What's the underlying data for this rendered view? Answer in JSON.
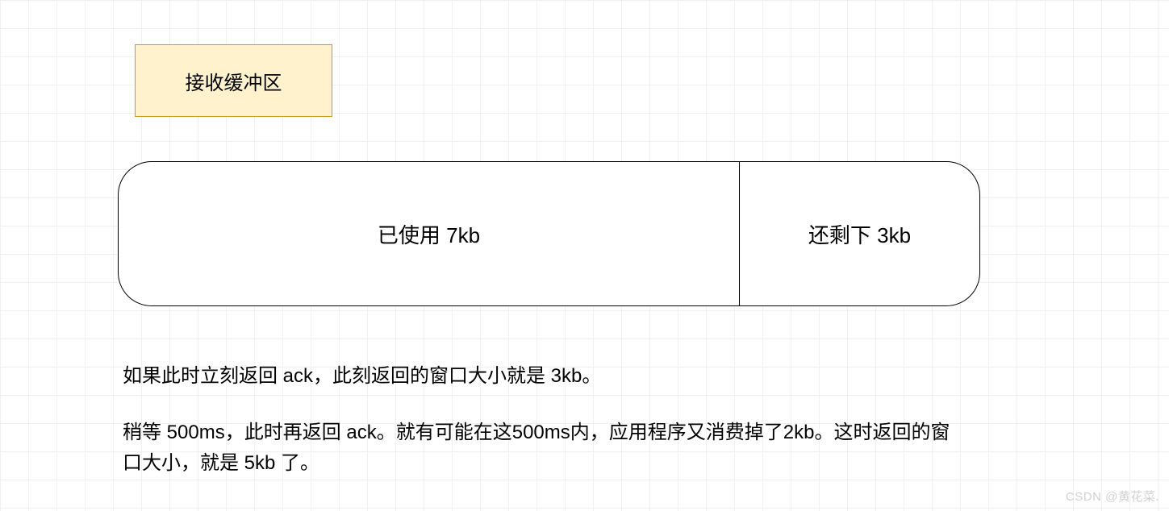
{
  "title": "接收缓冲区",
  "buffer": {
    "used_label": "已使用 7kb",
    "free_label": "还剩下 3kb"
  },
  "caption": {
    "line1": "如果此时立刻返回 ack，此刻返回的窗口大小就是 3kb。",
    "line2": "稍等 500ms，此时再返回 ack。就有可能在这500ms内，应用程序又消费掉了2kb。这时返回的窗口大小，就是 5kb 了。"
  },
  "watermark": "CSDN @黄花菜.",
  "chart_data": {
    "type": "bar",
    "title": "接收缓冲区",
    "categories": [
      "已使用",
      "还剩下"
    ],
    "values": [
      7,
      3
    ],
    "unit": "kb",
    "total": 10,
    "notes": [
      "立刻返回 ack → 窗口大小 3kb",
      "稍等 500ms 后返回 ack → 应用程序可能又消费 2kb → 窗口大小 5kb"
    ]
  }
}
